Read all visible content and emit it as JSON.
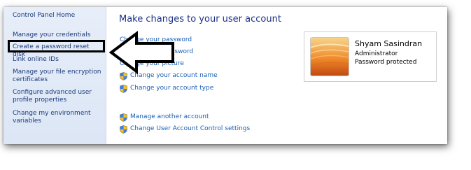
{
  "sidebar": {
    "home": "Control Panel Home",
    "items": [
      {
        "label": "Manage your credentials"
      },
      {
        "label": "Create a password reset disk"
      },
      {
        "label": "Link online IDs"
      },
      {
        "label": "Manage your file encryption certificates"
      },
      {
        "label": "Configure advanced user profile properties"
      },
      {
        "label": "Change my environment variables"
      }
    ]
  },
  "main": {
    "heading": "Make changes to your user account",
    "tasks": [
      {
        "label": "Change your password",
        "icon": null
      },
      {
        "label": "Remove your password",
        "icon": null
      },
      {
        "label": "Change your picture",
        "icon": null
      },
      {
        "label": "Change your account name",
        "icon": "uac-shield-icon"
      },
      {
        "label": "Change your account type",
        "icon": "uac-shield-icon"
      }
    ],
    "other_tasks": [
      {
        "label": "Manage another account",
        "icon": "uac-shield-icon"
      },
      {
        "label": "Change User Account Control settings",
        "icon": "uac-shield-icon"
      }
    ]
  },
  "user": {
    "name": "Shyam Sasindran",
    "role": "Administrator",
    "status": "Password protected"
  },
  "colors": {
    "link": "#1a5fb4",
    "heading": "#1e3287",
    "sidebar_bg": "#e7eef9",
    "highlight": "#000000"
  }
}
